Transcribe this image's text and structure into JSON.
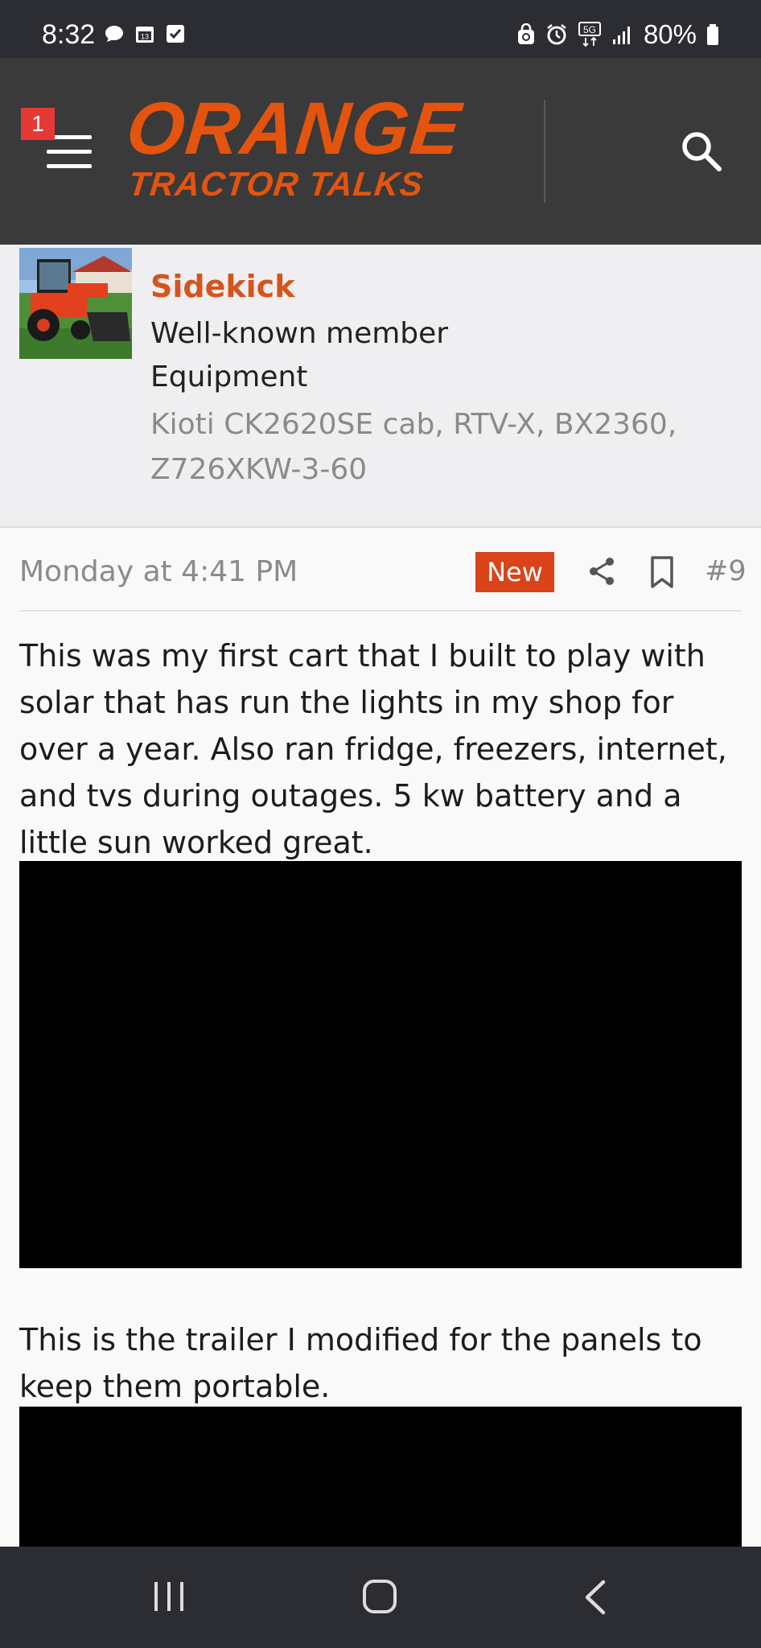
{
  "status_bar": {
    "time": "8:32",
    "battery": "80%",
    "calendar_day": "13",
    "network": "5G"
  },
  "header": {
    "notification_count": "1",
    "logo_line1": "ORANGE",
    "logo_line2": "TRACTOR TALKS"
  },
  "member": {
    "name": "Sidekick",
    "title": "Well-known member",
    "equipment_label": "Equipment",
    "equipment": "Kioti CK2620SE cab, RTV-X, BX2360, Z726XKW-3-60"
  },
  "post": {
    "date": "Monday at 4:41 PM",
    "new_badge": "New",
    "number": "#9",
    "paragraph1": "This was my first cart that I built to play with solar that has run the lights in my shop for over a year. Also ran fridge, freezers, internet, and tvs during outages. 5 kw battery and a little sun worked great.",
    "paragraph2": "This is the trailer I modified for the panels to keep them portable."
  },
  "colors": {
    "brand_orange": "#e4540f",
    "new_badge": "#d9441a",
    "header_bg": "#3a3a3a"
  }
}
